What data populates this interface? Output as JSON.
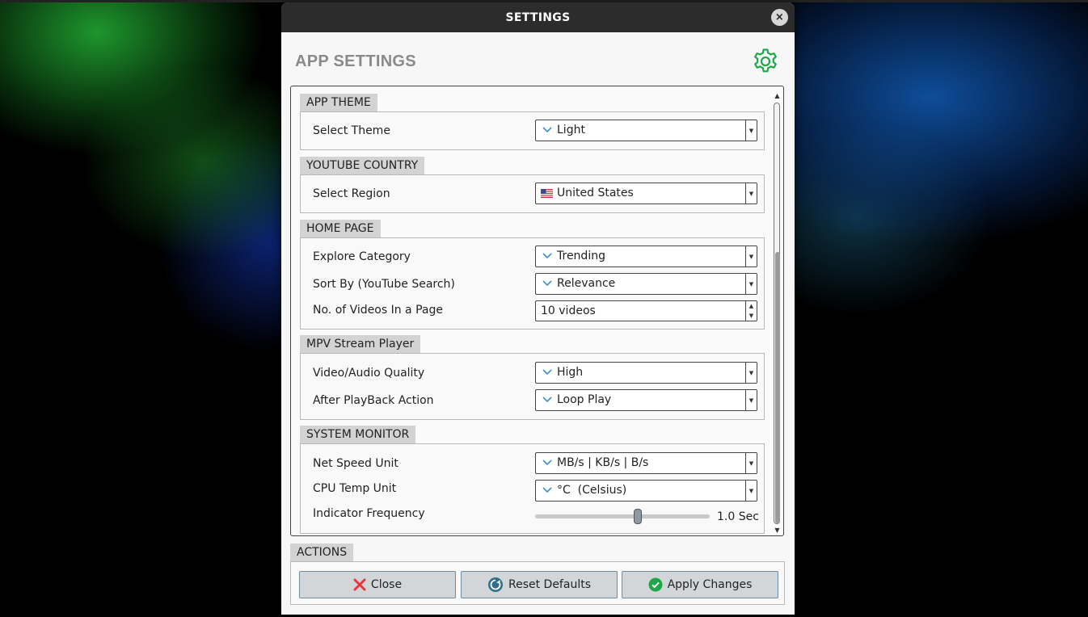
{
  "window": {
    "title": "SETTINGS",
    "close_glyph": "×"
  },
  "app": {
    "title": "APP SETTINGS",
    "header_icon": "gear-icon",
    "accent_color": "#1fa84a"
  },
  "groups": {
    "app_theme": {
      "title": "APP THEME",
      "rows": [
        {
          "label": "Select Theme",
          "value": "Light"
        }
      ]
    },
    "youtube_country": {
      "title": "YOUTUBE COUNTRY",
      "rows": [
        {
          "label": "Select Region",
          "value": "United States",
          "icon": "us-flag-icon"
        }
      ]
    },
    "home_page": {
      "title": "HOME PAGE",
      "rows": [
        {
          "label": "Explore Category",
          "value": "Trending"
        },
        {
          "label": "Sort By (YouTube Search)",
          "value": "Relevance"
        },
        {
          "label": "No. of Videos In a Page",
          "value": "10 videos"
        }
      ]
    },
    "mpv_player": {
      "title": "MPV Stream Player",
      "rows": [
        {
          "label": "Video/Audio Quality",
          "value": "High"
        },
        {
          "label": "After PlayBack Action",
          "value": "Loop Play"
        }
      ]
    },
    "system_monitor": {
      "title": "SYSTEM MONITOR",
      "rows": [
        {
          "label": "Net Speed Unit",
          "value": "MB/s | KB/s | B/s"
        },
        {
          "label": "CPU Temp Unit",
          "value": "°C  (Celsius)"
        },
        {
          "label": "Indicator Frequency",
          "value": "1.0 Sec",
          "slider_fraction": 0.59
        }
      ]
    }
  },
  "actions": {
    "title": "ACTIONS",
    "close_label": "Close",
    "reset_label": "Reset Defaults",
    "apply_label": "Apply Changes",
    "close_color": "#e8343c",
    "reset_color": "#2f6f8a",
    "apply_color": "#1fa84a"
  },
  "scroll": {
    "thumb_fraction": 0.64
  }
}
